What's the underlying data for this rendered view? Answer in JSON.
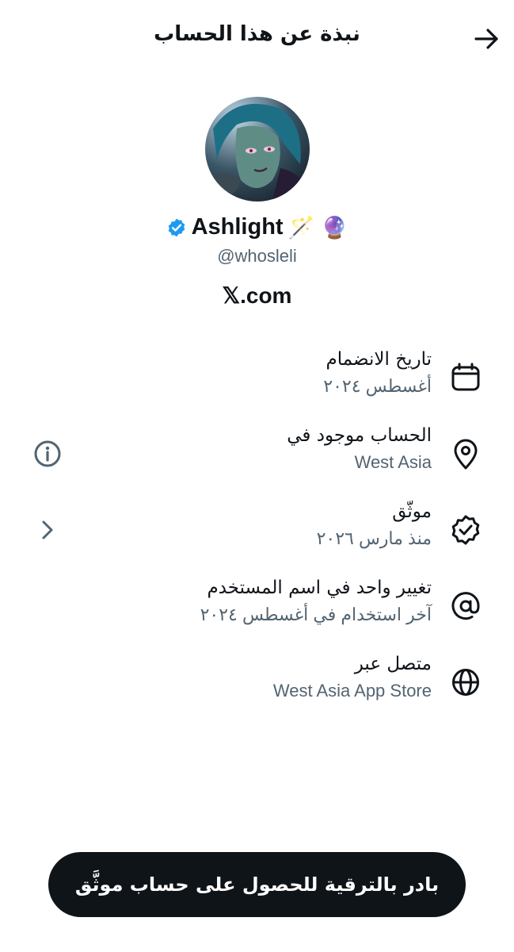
{
  "header": {
    "title": "نبذة عن هذا الحساب",
    "back_icon": "arrow-right-icon"
  },
  "profile": {
    "name": "Ashlight",
    "emojis": "🪄 🔮",
    "handle": "@whosleli",
    "site": "𝕏.com",
    "verified_color": "#1d9bf0"
  },
  "rows": [
    {
      "title": "تاريخ الانضمام",
      "subtitle": "أغسطس ٢٠٢٤",
      "icon": "calendar-icon"
    },
    {
      "title": "الحساب موجود في",
      "subtitle": "West Asia",
      "icon": "location-pin-icon",
      "left_icon": "info-icon"
    },
    {
      "title": "موثّق",
      "subtitle": "منذ مارس ٢٠٢٦",
      "icon": "verified-badge-icon",
      "left_icon": "chevron-right-icon"
    },
    {
      "title": "تغيير واحد في اسم المستخدم",
      "subtitle": "آخر استخدام في أغسطس ٢٠٢٤",
      "icon": "at-sign-icon"
    },
    {
      "title": "متصل عبر",
      "subtitle": "West Asia App Store",
      "icon": "globe-icon"
    }
  ],
  "upgrade_button": {
    "label": "بادر بالترقية للحصول على حساب موثَّق"
  },
  "colors": {
    "text": "#0f1419",
    "secondary": "#536471",
    "button_bg": "#0f1419"
  }
}
